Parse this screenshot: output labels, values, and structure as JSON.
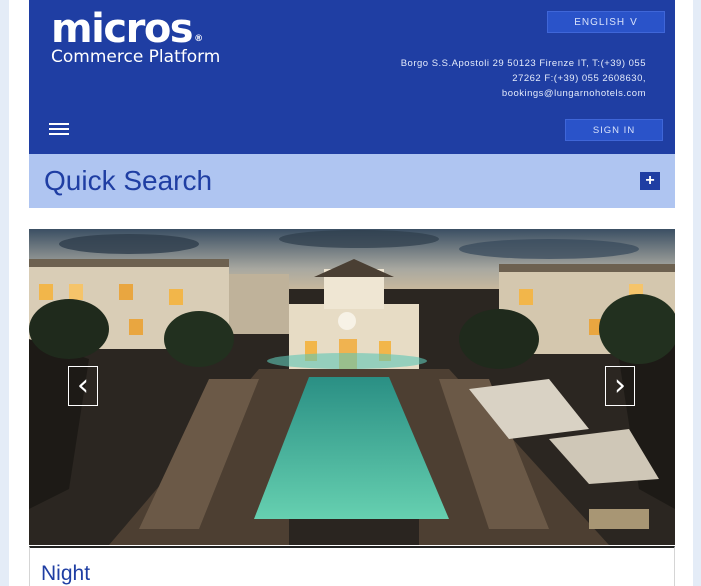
{
  "header": {
    "logo_main": "micros",
    "logo_mark": "®",
    "logo_sub": "Commerce Platform",
    "language_button": "ENGLISH",
    "language_chevron": "V",
    "address_line1": "Borgo S.S.Apostoli 29 50123 Firenze IT, T:(+39) 055",
    "address_line2": "27262 F:(+39) 055 2608630,",
    "address_line3": "bookings@lungarnohotels.com",
    "sign_in": "SIGN IN",
    "menu_icon": "hamburger-menu-icon"
  },
  "quick_search": {
    "title": "Quick Search",
    "expand_icon": "plus-icon",
    "expand_symbol": "+"
  },
  "carousel": {
    "prev_icon": "chevron-left-icon",
    "next_icon": "chevron-right-icon",
    "prev_symbol": "‹",
    "next_symbol": "›",
    "caption": "Night"
  },
  "colors": {
    "header_bg": "#1f3ea3",
    "quick_search_bg": "#afc5f1",
    "accent_text": "#1f3ea3"
  }
}
